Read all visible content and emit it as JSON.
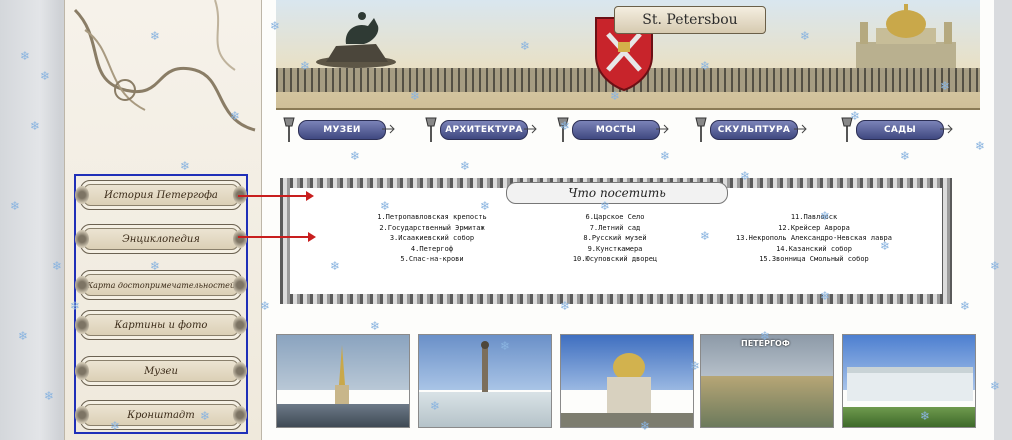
{
  "banner": {
    "title": "St. Petersbou"
  },
  "nav": {
    "items": [
      {
        "label": "МУЗЕИ"
      },
      {
        "label": "АРХИТЕКТУРА"
      },
      {
        "label": "МОСТЫ"
      },
      {
        "label": "СКУЛЬПТУРА"
      },
      {
        "label": "САДЫ"
      }
    ]
  },
  "sidebar": {
    "items": [
      {
        "label": "История Петергофа"
      },
      {
        "label": "Энциклопедия"
      },
      {
        "label": "Карта достопримечательностей"
      },
      {
        "label": "Картины и фото"
      },
      {
        "label": "Музеи"
      },
      {
        "label": "Кронштадт"
      }
    ]
  },
  "visit": {
    "title": "Что посетить",
    "col1": [
      "1.Петропавловская крепость",
      "2.Государственный Эрмитаж",
      "3.Исаакиевский собор",
      "4.Петергоф",
      "5.Спас-на-крови"
    ],
    "col2": [
      "6.Царское Село",
      "7.Летний сад",
      "8.Русский музей",
      "9.Кунсткамера",
      "10.Юсуповский дворец"
    ],
    "col3": [
      "11.Павловск",
      "12.Крейсер Аврора",
      "13.Некрополь Александро-Невская лавра",
      "14.Казанский собор",
      "15.Звонница Смольный собор"
    ]
  },
  "photos": {
    "items": [
      {
        "label": ""
      },
      {
        "label": ""
      },
      {
        "label": ""
      },
      {
        "label": "ПЕТЕРГОФ"
      },
      {
        "label": ""
      }
    ]
  },
  "colors": {
    "nav_plaque": "#4b5390",
    "menu_frame": "#1f2fb8",
    "arrow": "#c81e1e",
    "snow": "#8ab4e0"
  }
}
